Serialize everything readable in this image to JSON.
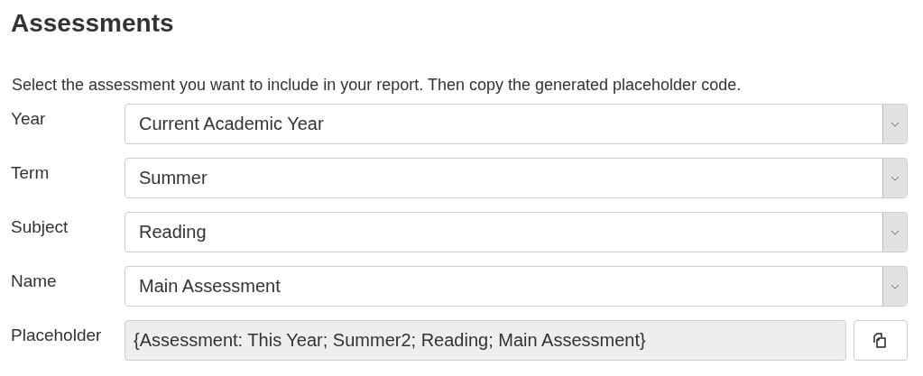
{
  "title": "Assessments",
  "intro": "Select the assessment you want to include in your report. Then copy the generated placeholder code.",
  "fields": [
    {
      "label": "Year",
      "value": "Current Academic Year"
    },
    {
      "label": "Term",
      "value": "Summer"
    },
    {
      "label": "Subject",
      "value": "Reading"
    },
    {
      "label": "Name",
      "value": "Main Assessment"
    }
  ],
  "placeholder": {
    "label": "Placeholder",
    "value": "{Assessment: This Year; Summer2; Reading; Main Assessment}"
  }
}
